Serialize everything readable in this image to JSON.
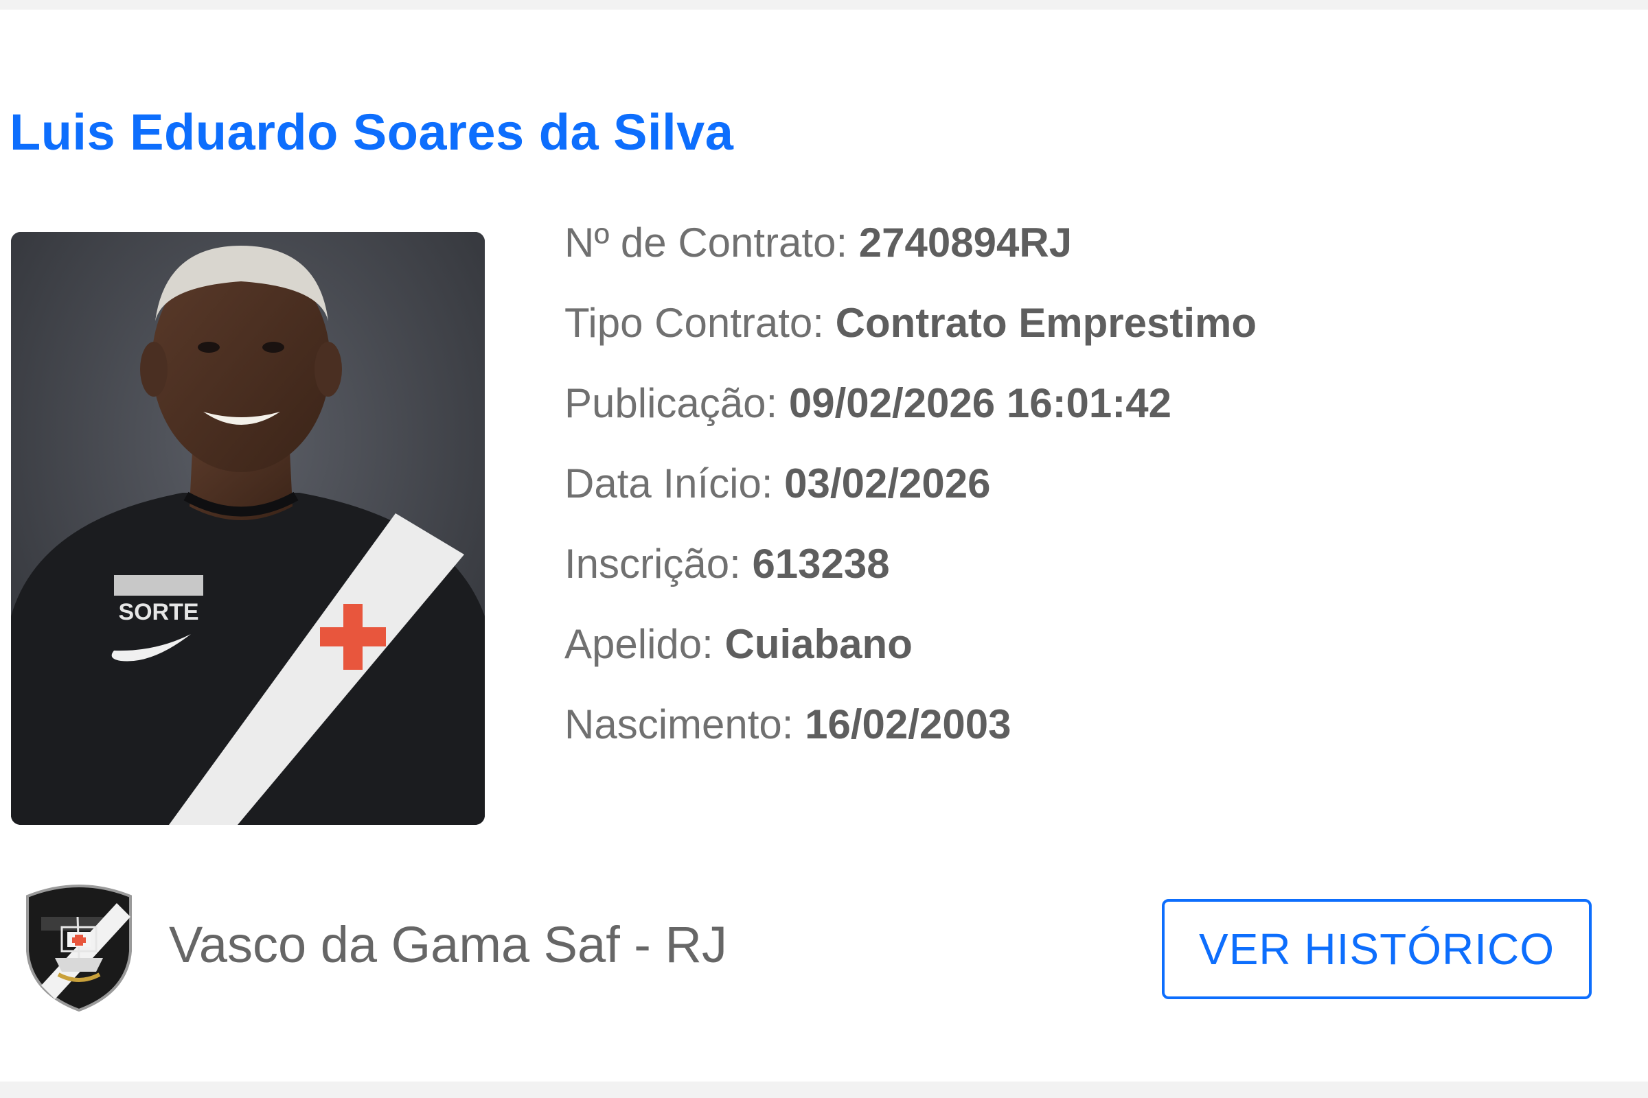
{
  "player": {
    "name": "Luis Eduardo Soares da Silva"
  },
  "photo": {
    "sponsor_text": "SORTE"
  },
  "details": [
    {
      "label": "Nº de Contrato:",
      "value": "2740894RJ"
    },
    {
      "label": "Tipo Contrato:",
      "value": "Contrato Emprestimo"
    },
    {
      "label": "Publicação:",
      "value": "09/02/2026 16:01:42"
    },
    {
      "label": "Data Início:",
      "value": "03/02/2026"
    },
    {
      "label": "Inscrição:",
      "value": "613238"
    },
    {
      "label": "Apelido:",
      "value": "Cuiabano"
    },
    {
      "label": "Nascimento:",
      "value": "16/02/2003"
    }
  ],
  "club": {
    "name": "Vasco da Gama Saf - RJ"
  },
  "actions": {
    "history_label": "VER HISTÓRICO"
  },
  "colors": {
    "accent": "#0d6efd",
    "label_text": "#707070",
    "value_text": "#5e5e5e",
    "page_background": "#f2f2f2",
    "card_background": "#ffffff",
    "cross": "#e8563d"
  }
}
